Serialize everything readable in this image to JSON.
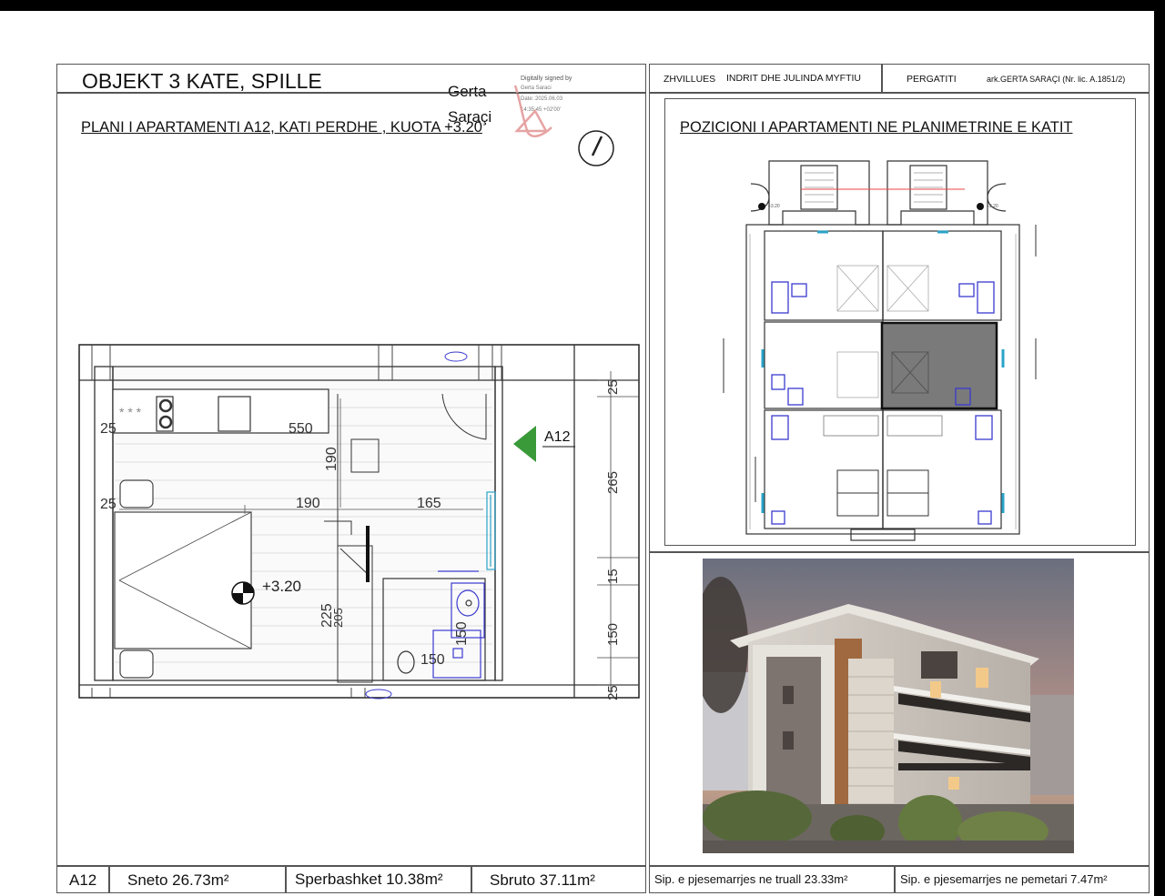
{
  "header": {
    "title": "OBJEKT 3 KATE, SPILLE",
    "developer_label": "ZHVILLUES",
    "developer_name": "INDRIT DHE JULINDA MYFTIU",
    "prepared_label": "PERGATITI",
    "prepared_name": "ark.GERTA SARAÇI (Nr. lic. A.1851/2)"
  },
  "signature": {
    "name_line1": "Gerta",
    "name_line2": "Saraçi",
    "digital_line1": "Digitally signed by",
    "digital_line2": "Gerta Saraci",
    "digital_line3": "Date: 2025.06.03",
    "digital_line4": "14:35:45 +02'00'"
  },
  "plan": {
    "subtitle": "PLANI I APARTAMENTI A12, KATI PERDHE , KUOTA +3.20",
    "apartment_tag": "A12",
    "level_mark": "+3.20",
    "dims": {
      "d550": "550",
      "d190v": "190",
      "d190h": "190",
      "d165": "165",
      "d225": "225",
      "d205": "205",
      "d150v": "150",
      "d150h": "150",
      "s25a": "25",
      "s265": "265",
      "s15": "15",
      "s150": "150",
      "s25b": "25",
      "l25a": "25",
      "l25b": "25"
    }
  },
  "position": {
    "title": "POZICIONI I APARTAMENTI NE PLANIMETRINE E KATIT",
    "level_left": "+3.20",
    "level_right": "+3.20"
  },
  "footer": {
    "apt": "A12",
    "sneto": "Sneto  26.73m²",
    "sperbashket": "Sperbashket  10.38m²",
    "sbruto": "Sbruto  37.11m²",
    "truall": "Sip. e pjesemarrjes ne truall  23.33m²",
    "pemetari": "Sip. e pjesemarrjes ne pemetari  7.47m²"
  },
  "colors": {
    "highlight": "#7a7a7a",
    "arrow": "#3a9a3a",
    "blue_fixture": "#3a3ad0",
    "window": "#2aa3c8"
  }
}
